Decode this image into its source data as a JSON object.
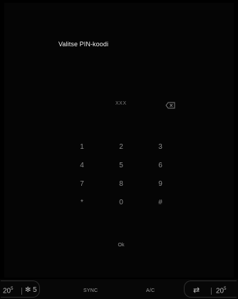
{
  "screen": {
    "title": "Valitse PIN-koodi",
    "pin_display": "XXX",
    "backspace_icon": "backspace-icon",
    "keys": [
      "1",
      "2",
      "3",
      "4",
      "5",
      "6",
      "7",
      "8",
      "9",
      "*",
      "0",
      "#"
    ],
    "ok_label": "Ok"
  },
  "bottom_bar": {
    "left_temp": "20",
    "left_temp_sup": "5",
    "fan_level": "5",
    "sync_label": "SYNC",
    "ac_label": "A/C",
    "right_temp": "20",
    "right_temp_sup": "5"
  },
  "colors": {
    "background": "#000000",
    "text_primary": "#f4f4f4",
    "text_dim": "#8c8c8c"
  }
}
